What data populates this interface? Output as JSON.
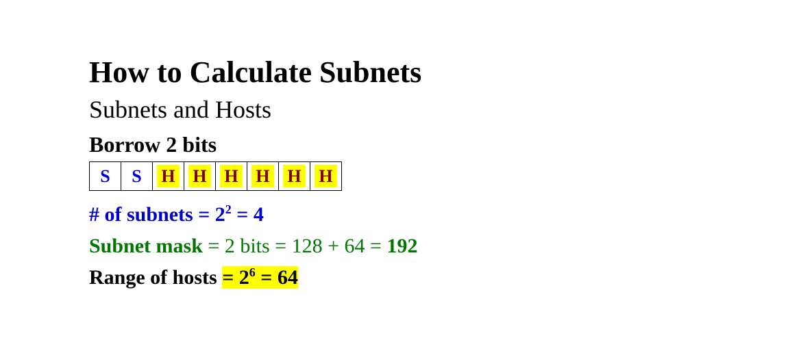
{
  "title": "How to Calculate Subnets",
  "subtitle": "Subnets and Hosts",
  "borrow_label": "Borrow 2 bits",
  "bits": {
    "s1": "S",
    "s2": "S",
    "h1": "H",
    "h2": "H",
    "h3": "H",
    "h4": "H",
    "h5": "H",
    "h6": "H"
  },
  "subnets_line": {
    "prefix": "# of subnets = 2",
    "exponent": "2",
    "suffix": " = 4"
  },
  "mask_line": {
    "label": "Subnet mask",
    "middle": " = 2 bits = 128 + 64 = ",
    "result": "192"
  },
  "hosts_line": {
    "label": "Range of hosts ",
    "eq1": "= 2",
    "exponent": "6",
    "suffix": " = 64"
  }
}
